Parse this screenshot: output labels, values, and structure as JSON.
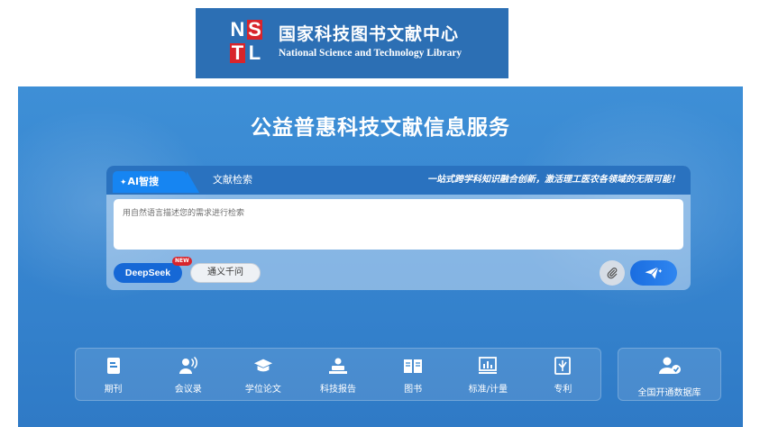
{
  "logo": {
    "mark": [
      "N",
      "S",
      "T",
      "L"
    ],
    "name_cn": "国家科技图书文献中心",
    "name_en": "National Science and Technology Library"
  },
  "hero": {
    "title": "公益普惠科技文献信息服务"
  },
  "search": {
    "tabs": [
      {
        "label": "AI智搜",
        "active": true
      },
      {
        "label": "文献检索",
        "active": false
      }
    ],
    "slogan": "一站式跨学科知识融合创新，激活理工医农各领域的无限可能！",
    "placeholder": "用自然语言描述您的需求进行检索",
    "models": [
      {
        "label": "DeepSeek",
        "badge": "NEW",
        "selected": true
      },
      {
        "label": "通义千问",
        "selected": false
      }
    ],
    "attach_icon": "paperclip-icon",
    "send_icon": "paper-plane-icon"
  },
  "categories": [
    {
      "label": "期刊",
      "icon": "journal-icon"
    },
    {
      "label": "会议录",
      "icon": "speaker-icon"
    },
    {
      "label": "学位论文",
      "icon": "graduation-cap-icon"
    },
    {
      "label": "科技报告",
      "icon": "report-icon"
    },
    {
      "label": "图书",
      "icon": "book-icon"
    },
    {
      "label": "标准/计量",
      "icon": "standard-icon"
    },
    {
      "label": "专利",
      "icon": "patent-icon"
    }
  ],
  "open_db": {
    "label": "全国开通数据库",
    "icon": "user-check-icon"
  },
  "colors": {
    "banner": "#2c6fb4",
    "hero": "#3887d1",
    "tab_active": "#1685f2",
    "deepseek": "#1668d6",
    "new_badge": "#d8242b",
    "logo_red": "#d8242b"
  }
}
